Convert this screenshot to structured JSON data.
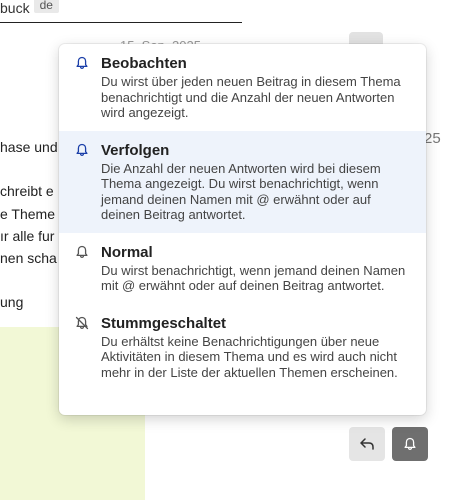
{
  "background": {
    "top_text": "buck",
    "top_tag": "de",
    "date_fragment": "15. Sep. 2025",
    "right_number": "25",
    "body_lines": [
      {
        "text": "hase und"
      },
      {
        "text": "chreibt e"
      },
      {
        "text": "e Theme"
      },
      {
        "text": "ır alle fur"
      },
      {
        "text": "nen scha"
      },
      {
        "text": "ung"
      }
    ]
  },
  "menu": {
    "items": [
      {
        "name": "watching",
        "title": "Beobachten",
        "description": "Du wirst über jeden neuen Beitrag in diesem Thema benachrichtigt und die Anzahl der neuen Antworten wird angezeigt.",
        "icon": "bell-icon",
        "active": false
      },
      {
        "name": "tracking",
        "title": "Verfolgen",
        "description": "Die Anzahl der neuen Antworten wird bei diesem Thema angezeigt. Du wirst benachrichtigt, wenn jemand deinen Namen mit @ erwähnt oder auf deinen Beitrag antwortet.",
        "icon": "bell-icon",
        "active": true
      },
      {
        "name": "normal",
        "title": "Normal",
        "description": "Du wirst benachrichtigt, wenn jemand deinen Namen mit @ erwähnt oder auf deinen Beitrag antwortet.",
        "icon": "bell-icon",
        "active": false
      },
      {
        "name": "muted",
        "title": "Stummgeschaltet",
        "description": "Du erhältst keine Benachrichtigungen über neue Aktivitäten in diesem Thema und es wird auch nicht mehr in der Liste der aktuellen Themen erscheinen.",
        "icon": "bell-slash-icon",
        "active": false
      }
    ]
  },
  "colors": {
    "accent_icon": "#1a3ea8",
    "muted_icon": "#555555",
    "active_bg": "#eef3fb",
    "button_dark": "#6f6f6f"
  }
}
